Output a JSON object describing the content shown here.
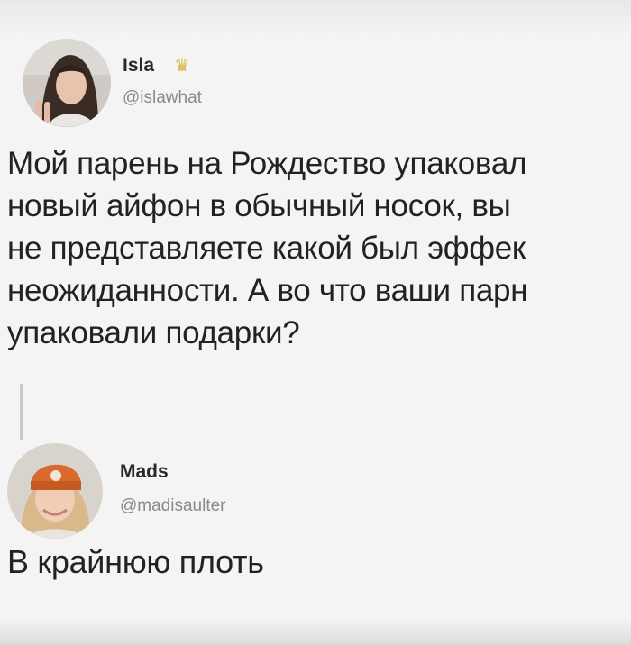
{
  "tweet": {
    "author_name": "Isla",
    "author_badge_icon": "crown-icon",
    "author_handle": "@islawhat",
    "text": "Мой парень на Рождество упаковал\nновый айфон в обычный носок, вы\nне представляете какой был эффек\nнеожиданности. А во что ваши парн\nупаковали подарки?"
  },
  "reply": {
    "author_name": "Mads",
    "author_handle": "@madisaulter",
    "text": "В крайнюю плоть"
  }
}
